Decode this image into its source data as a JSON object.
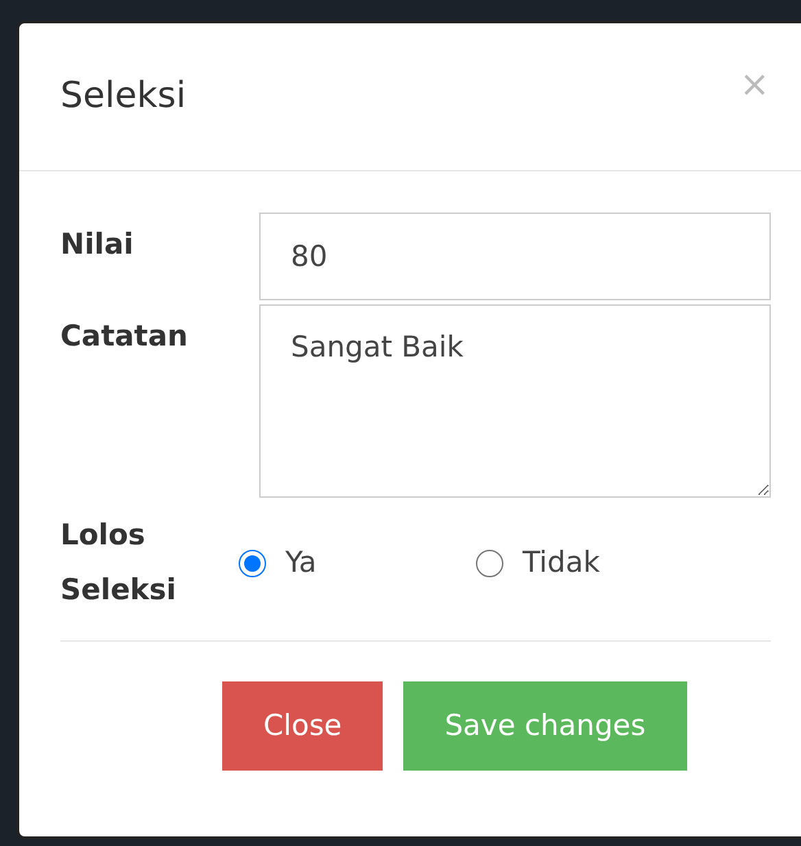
{
  "modal": {
    "title": "Seleksi",
    "close_icon": "×"
  },
  "fields": [
    {
      "kind": "input",
      "label": "Nilai",
      "value": "80"
    },
    {
      "kind": "textarea",
      "label": "Catatan",
      "value": "Sangat Baik"
    }
  ],
  "radio_group": {
    "label": "Lolos Seleksi",
    "options": [
      {
        "label": "Ya",
        "selected": true
      },
      {
        "label": "Tidak",
        "selected": false
      }
    ]
  },
  "buttons": [
    {
      "kind": "danger",
      "label": "Close"
    },
    {
      "kind": "success",
      "label": "Save changes"
    }
  ]
}
